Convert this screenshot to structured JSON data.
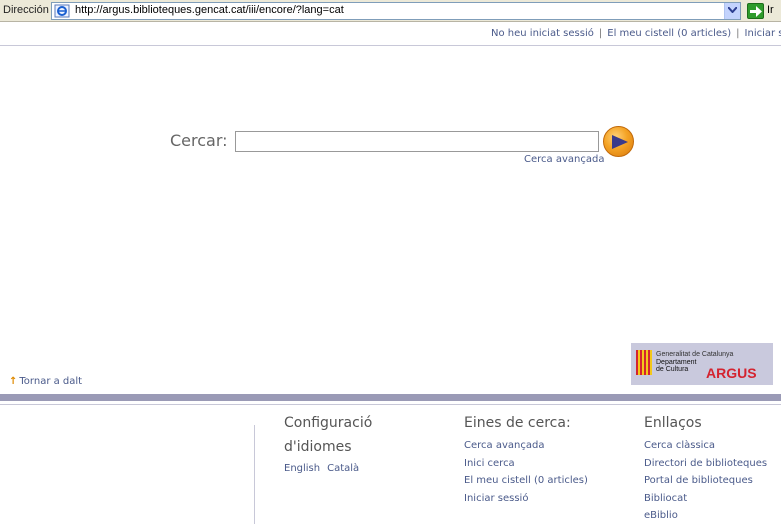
{
  "browser": {
    "address_label": "Dirección",
    "url": "http://argus.biblioteques.gencat.cat/iii/encore/?lang=cat",
    "go_label": "Ir"
  },
  "user_links": [
    {
      "label": "No heu iniciat sessió"
    },
    {
      "label": "El meu cistell (0 articles)"
    },
    {
      "label": "Iniciar se"
    }
  ],
  "search": {
    "label": "Cercar:",
    "value": "",
    "advanced_link": "Cerca avançada"
  },
  "back_to_top": "Tornar a dalt",
  "logo": {
    "line1": "Generalitat de Catalunya",
    "line2": "Departament",
    "line3": "de Cultura",
    "brand": "ARGUS"
  },
  "footer": {
    "languages": {
      "title_line1": "Configuració",
      "title_line2": "d'idiomes",
      "items": [
        "English",
        "Català"
      ]
    },
    "tools": {
      "title": "Eines de cerca:",
      "items": [
        "Cerca avançada",
        "Inici cerca",
        "El meu cistell (0 articles)",
        "Iniciar sessió"
      ]
    },
    "links": {
      "title": "Enllaços",
      "items": [
        "Cerca clàssica",
        "Directori de biblioteques",
        "Portal de biblioteques",
        "Bibliocat",
        "eBiblio"
      ]
    }
  },
  "colors": {
    "link": "#4a5a8a",
    "accent_orange": "#f4a325",
    "footer_bar": "#9a9ab6",
    "brand_red": "#d4232f"
  }
}
